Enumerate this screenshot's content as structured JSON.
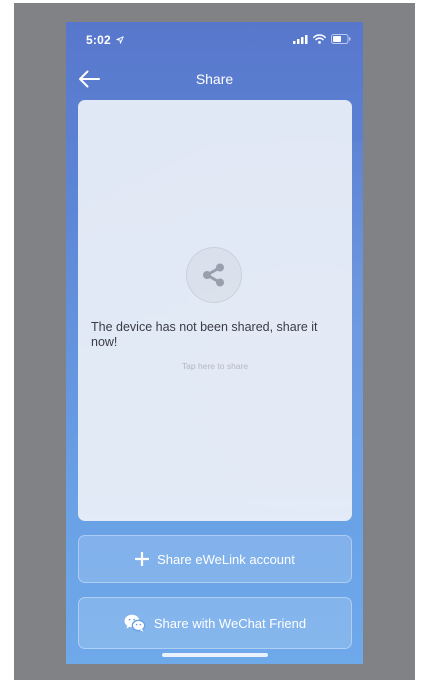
{
  "status_bar": {
    "time": "5:02",
    "icons": [
      "location-arrow-icon",
      "cellular-signal-icon",
      "wifi-icon",
      "battery-icon"
    ]
  },
  "nav": {
    "back_icon": "back-arrow-icon",
    "title": "Share"
  },
  "share_card": {
    "icon": "share-icon",
    "message": "The device has not been shared, share it now!",
    "hint": "Tap here to share"
  },
  "actions": {
    "share_account": {
      "icon": "plus-icon",
      "label": "Share eWeLink account"
    },
    "share_wechat": {
      "icon": "wechat-icon",
      "label": "Share with WeChat Friend"
    }
  },
  "colors": {
    "background_top": "#5877cc",
    "background_bottom": "#6ea9ea",
    "backdrop": "#818286",
    "card": "#ecf0f8",
    "message_text": "#3a3c44",
    "hint_text": "#b2b6c2"
  }
}
